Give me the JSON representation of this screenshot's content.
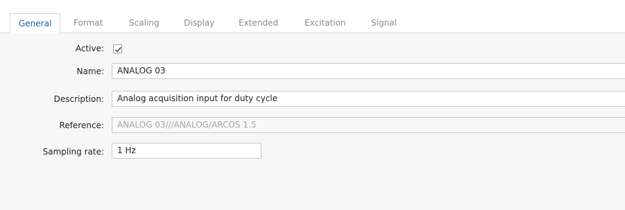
{
  "tabs": [
    {
      "label": "General",
      "active": true
    },
    {
      "label": "Format"
    },
    {
      "label": "Scaling"
    },
    {
      "label": "Display"
    },
    {
      "label": "Extended"
    },
    {
      "label": "Excitation"
    },
    {
      "label": "Signal"
    }
  ],
  "form": {
    "active": {
      "label": "Active:",
      "checked": true,
      "icon": "check-icon"
    },
    "name": {
      "label": "Name:",
      "value": "ANALOG 03"
    },
    "description": {
      "label": "Description:",
      "value": "Analog acquisition input for duty cycle"
    },
    "reference": {
      "label": "Reference:",
      "value": "ANALOG 03///ANALOG/ARCOS 1.5"
    },
    "sampling_rate": {
      "label": "Sampling rate:",
      "value": "1 Hz"
    }
  },
  "colors": {
    "active_tab": "#1f5fae",
    "inactive_tab": "#8a8a8a",
    "border": "#c9c9c9",
    "reference_text": "#a2a2a2"
  }
}
